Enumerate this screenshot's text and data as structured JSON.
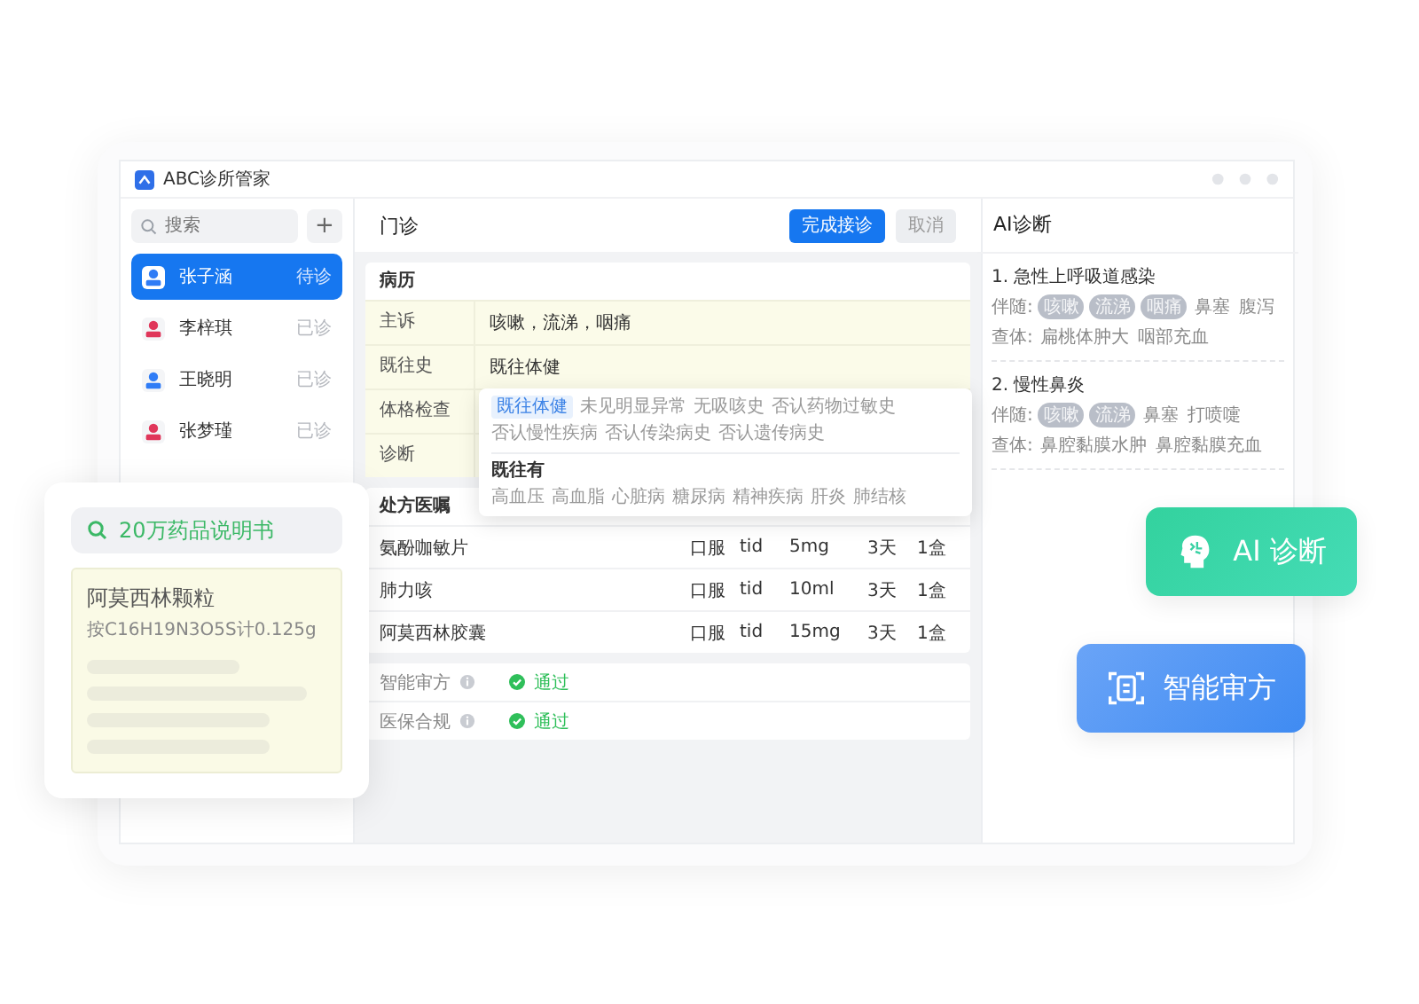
{
  "window": {
    "title": "ABC诊所管家"
  },
  "sidebar": {
    "search": {
      "placeholder": "搜索"
    },
    "add_button": "+",
    "patients": [
      {
        "name": "张子涵",
        "status": "待诊",
        "selected": true,
        "color": "#2f7cf6"
      },
      {
        "name": "李梓琪",
        "status": "已诊",
        "selected": false,
        "color": "#e0365a"
      },
      {
        "name": "王晓明",
        "status": "已诊",
        "selected": false,
        "color": "#2f7cf6"
      },
      {
        "name": "张梦瑾",
        "status": "已诊",
        "selected": false,
        "color": "#e0365a"
      }
    ]
  },
  "main": {
    "title": "门诊",
    "buttons": [
      {
        "label": "完成接诊",
        "kind": "primary"
      },
      {
        "label": "取消",
        "kind": "secondary"
      }
    ],
    "record": {
      "title": "病历",
      "rows": [
        {
          "label": "主诉",
          "value": "咳嗽，流涕，咽痛"
        },
        {
          "label": "既往史",
          "value": "既往体健"
        },
        {
          "label": "体格检查"
        },
        {
          "label": "诊断"
        }
      ]
    },
    "popup": {
      "groups": [
        {
          "options": [
            {
              "label": "既往体健",
              "selected": true
            },
            {
              "label": "未见明显异常",
              "selected": false
            },
            {
              "label": "无吸咳史",
              "selected": false
            },
            {
              "label": "否认药物过敏史",
              "selected": false
            },
            {
              "label": "否认慢性疾病",
              "selected": false
            },
            {
              "label": "否认传染病史",
              "selected": false
            },
            {
              "label": "否认遗传病史",
              "selected": false
            }
          ]
        },
        {
          "title": "既往有",
          "options": [
            {
              "label": "高血压",
              "selected": false
            },
            {
              "label": "高血脂",
              "selected": false
            },
            {
              "label": "心脏病",
              "selected": false
            },
            {
              "label": "糖尿病",
              "selected": false
            },
            {
              "label": "精神疾病",
              "selected": false
            },
            {
              "label": "肝炎",
              "selected": false
            },
            {
              "label": "肺结核",
              "selected": false
            }
          ]
        }
      ]
    },
    "prescription": {
      "title": "处方医嘱",
      "rows": [
        {
          "name": "氨酚咖敏片",
          "route": "口服",
          "freq": "tid",
          "dose": "5mg",
          "days": "3天",
          "qty": "1盒"
        },
        {
          "name": "肺力咳",
          "route": "口服",
          "freq": "tid",
          "dose": "10ml",
          "days": "3天",
          "qty": "1盒"
        },
        {
          "name": "阿莫西林胶囊",
          "route": "口服",
          "freq": "tid",
          "dose": "15mg",
          "days": "3天",
          "qty": "1盒"
        }
      ]
    },
    "checks": [
      {
        "label": "智能审方",
        "result": "通过"
      },
      {
        "label": "医保合规",
        "result": "通过"
      }
    ]
  },
  "ai": {
    "title": "AI诊断",
    "diagnoses": [
      {
        "title": "1. 急性上呼吸道感染",
        "accompany_label": "伴随:",
        "symptoms": [
          {
            "label": "咳嗽",
            "highlighted": true
          },
          {
            "label": "流涕",
            "highlighted": true
          },
          {
            "label": "咽痛",
            "highlighted": true
          },
          {
            "label": "鼻塞",
            "highlighted": false
          },
          {
            "label": "腹泻",
            "highlighted": false
          }
        ],
        "exam_label": "查体:",
        "findings": [
          "扁桃体肿大",
          "咽部充血"
        ]
      },
      {
        "title": "2. 慢性鼻炎",
        "accompany_label": "伴随:",
        "symptoms": [
          {
            "label": "咳嗽",
            "highlighted": true
          },
          {
            "label": "流涕",
            "highlighted": true
          },
          {
            "label": "鼻塞",
            "highlighted": false
          },
          {
            "label": "打喷嚏",
            "highlighted": false
          }
        ],
        "exam_label": "查体:",
        "findings": [
          "鼻腔黏膜水肿",
          "鼻腔黏膜充血"
        ]
      }
    ]
  },
  "drug_card": {
    "search": "20万药品说明书",
    "name": "阿莫西林颗粒",
    "spec": "按C16H19N3O5S计0.125g"
  },
  "badges": [
    {
      "label": "AI 诊断",
      "kind": "ai"
    },
    {
      "label": "智能审方",
      "kind": "review"
    }
  ]
}
